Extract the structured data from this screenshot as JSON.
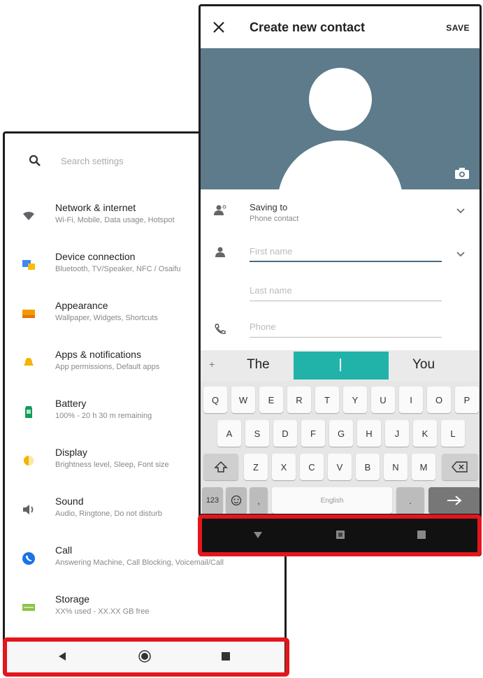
{
  "settings": {
    "search_placeholder": "Search settings",
    "items": [
      {
        "title": "Network & internet",
        "subtitle": "Wi-Fi, Mobile, Data usage, Hotspot",
        "icon": "wifi-icon",
        "color": "#5f6368"
      },
      {
        "title": "Device connection",
        "subtitle": "Bluetooth, TV/Speaker, NFC / Osaifu",
        "icon": "device-connection-icon",
        "color": "#4285f4"
      },
      {
        "title": "Appearance",
        "subtitle": "Wallpaper, Widgets, Shortcuts",
        "icon": "appearance-icon",
        "color": "#f29900"
      },
      {
        "title": "Apps & notifications",
        "subtitle": "App permissions, Default apps",
        "icon": "apps-notifications-icon",
        "color": "#f4b400"
      },
      {
        "title": "Battery",
        "subtitle": "100% - 20 h 30 m remaining",
        "icon": "battery-icon",
        "color": "#0f9d58"
      },
      {
        "title": "Display",
        "subtitle": "Brightness level, Sleep, Font size",
        "icon": "display-icon",
        "color": "#f4b400"
      },
      {
        "title": "Sound",
        "subtitle": "Audio, Ringtone, Do not disturb",
        "icon": "sound-icon",
        "color": "#5f6368"
      },
      {
        "title": "Call",
        "subtitle": "Answering Machine, Call Blocking, Voicemail/Call",
        "icon": "call-icon",
        "color": "#1a73e8"
      },
      {
        "title": "Storage",
        "subtitle": "XX% used - XX.XX GB free",
        "icon": "storage-icon",
        "color": "#8bc34a"
      }
    ]
  },
  "contact": {
    "title": "Create new contact",
    "save_label": "SAVE",
    "saving_to_label": "Saving to",
    "saving_to_value": "Phone contact",
    "first_name_placeholder": "First name",
    "last_name_placeholder": "Last name",
    "phone_placeholder": "Phone",
    "header_bg": "#5d7b8a"
  },
  "keyboard": {
    "suggestions": [
      "The",
      "I",
      "You"
    ],
    "row1": [
      "Q",
      "W",
      "E",
      "R",
      "T",
      "Y",
      "U",
      "I",
      "O",
      "P"
    ],
    "row2": [
      "A",
      "S",
      "D",
      "F",
      "G",
      "H",
      "J",
      "K",
      "L"
    ],
    "row3": [
      "Z",
      "X",
      "C",
      "V",
      "B",
      "N",
      "M"
    ],
    "num_key": "123",
    "comma_key": ",",
    "space_key": "English",
    "period_key": ".",
    "accent_color": "#21b3aa"
  },
  "highlight_color": "#e4161c"
}
